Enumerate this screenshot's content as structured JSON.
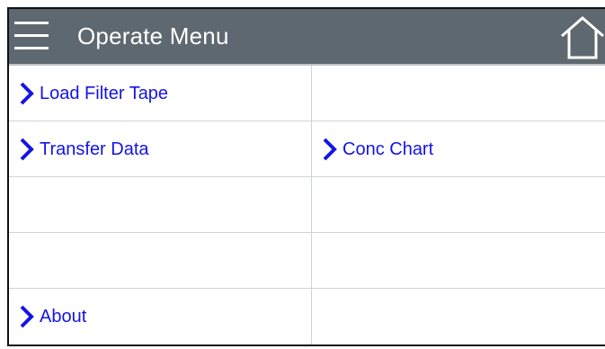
{
  "header": {
    "title": "Operate Menu",
    "menu_icon": "hamburger-menu-icon",
    "home_icon": "home-icon"
  },
  "colors": {
    "header_bg": "#5e6870",
    "link": "#1414e6",
    "divider": "#cfd3d6"
  },
  "menu": {
    "load_filter_tape": "Load Filter Tape",
    "transfer_data": "Transfer Data",
    "conc_chart": "Conc Chart",
    "about": "About"
  }
}
